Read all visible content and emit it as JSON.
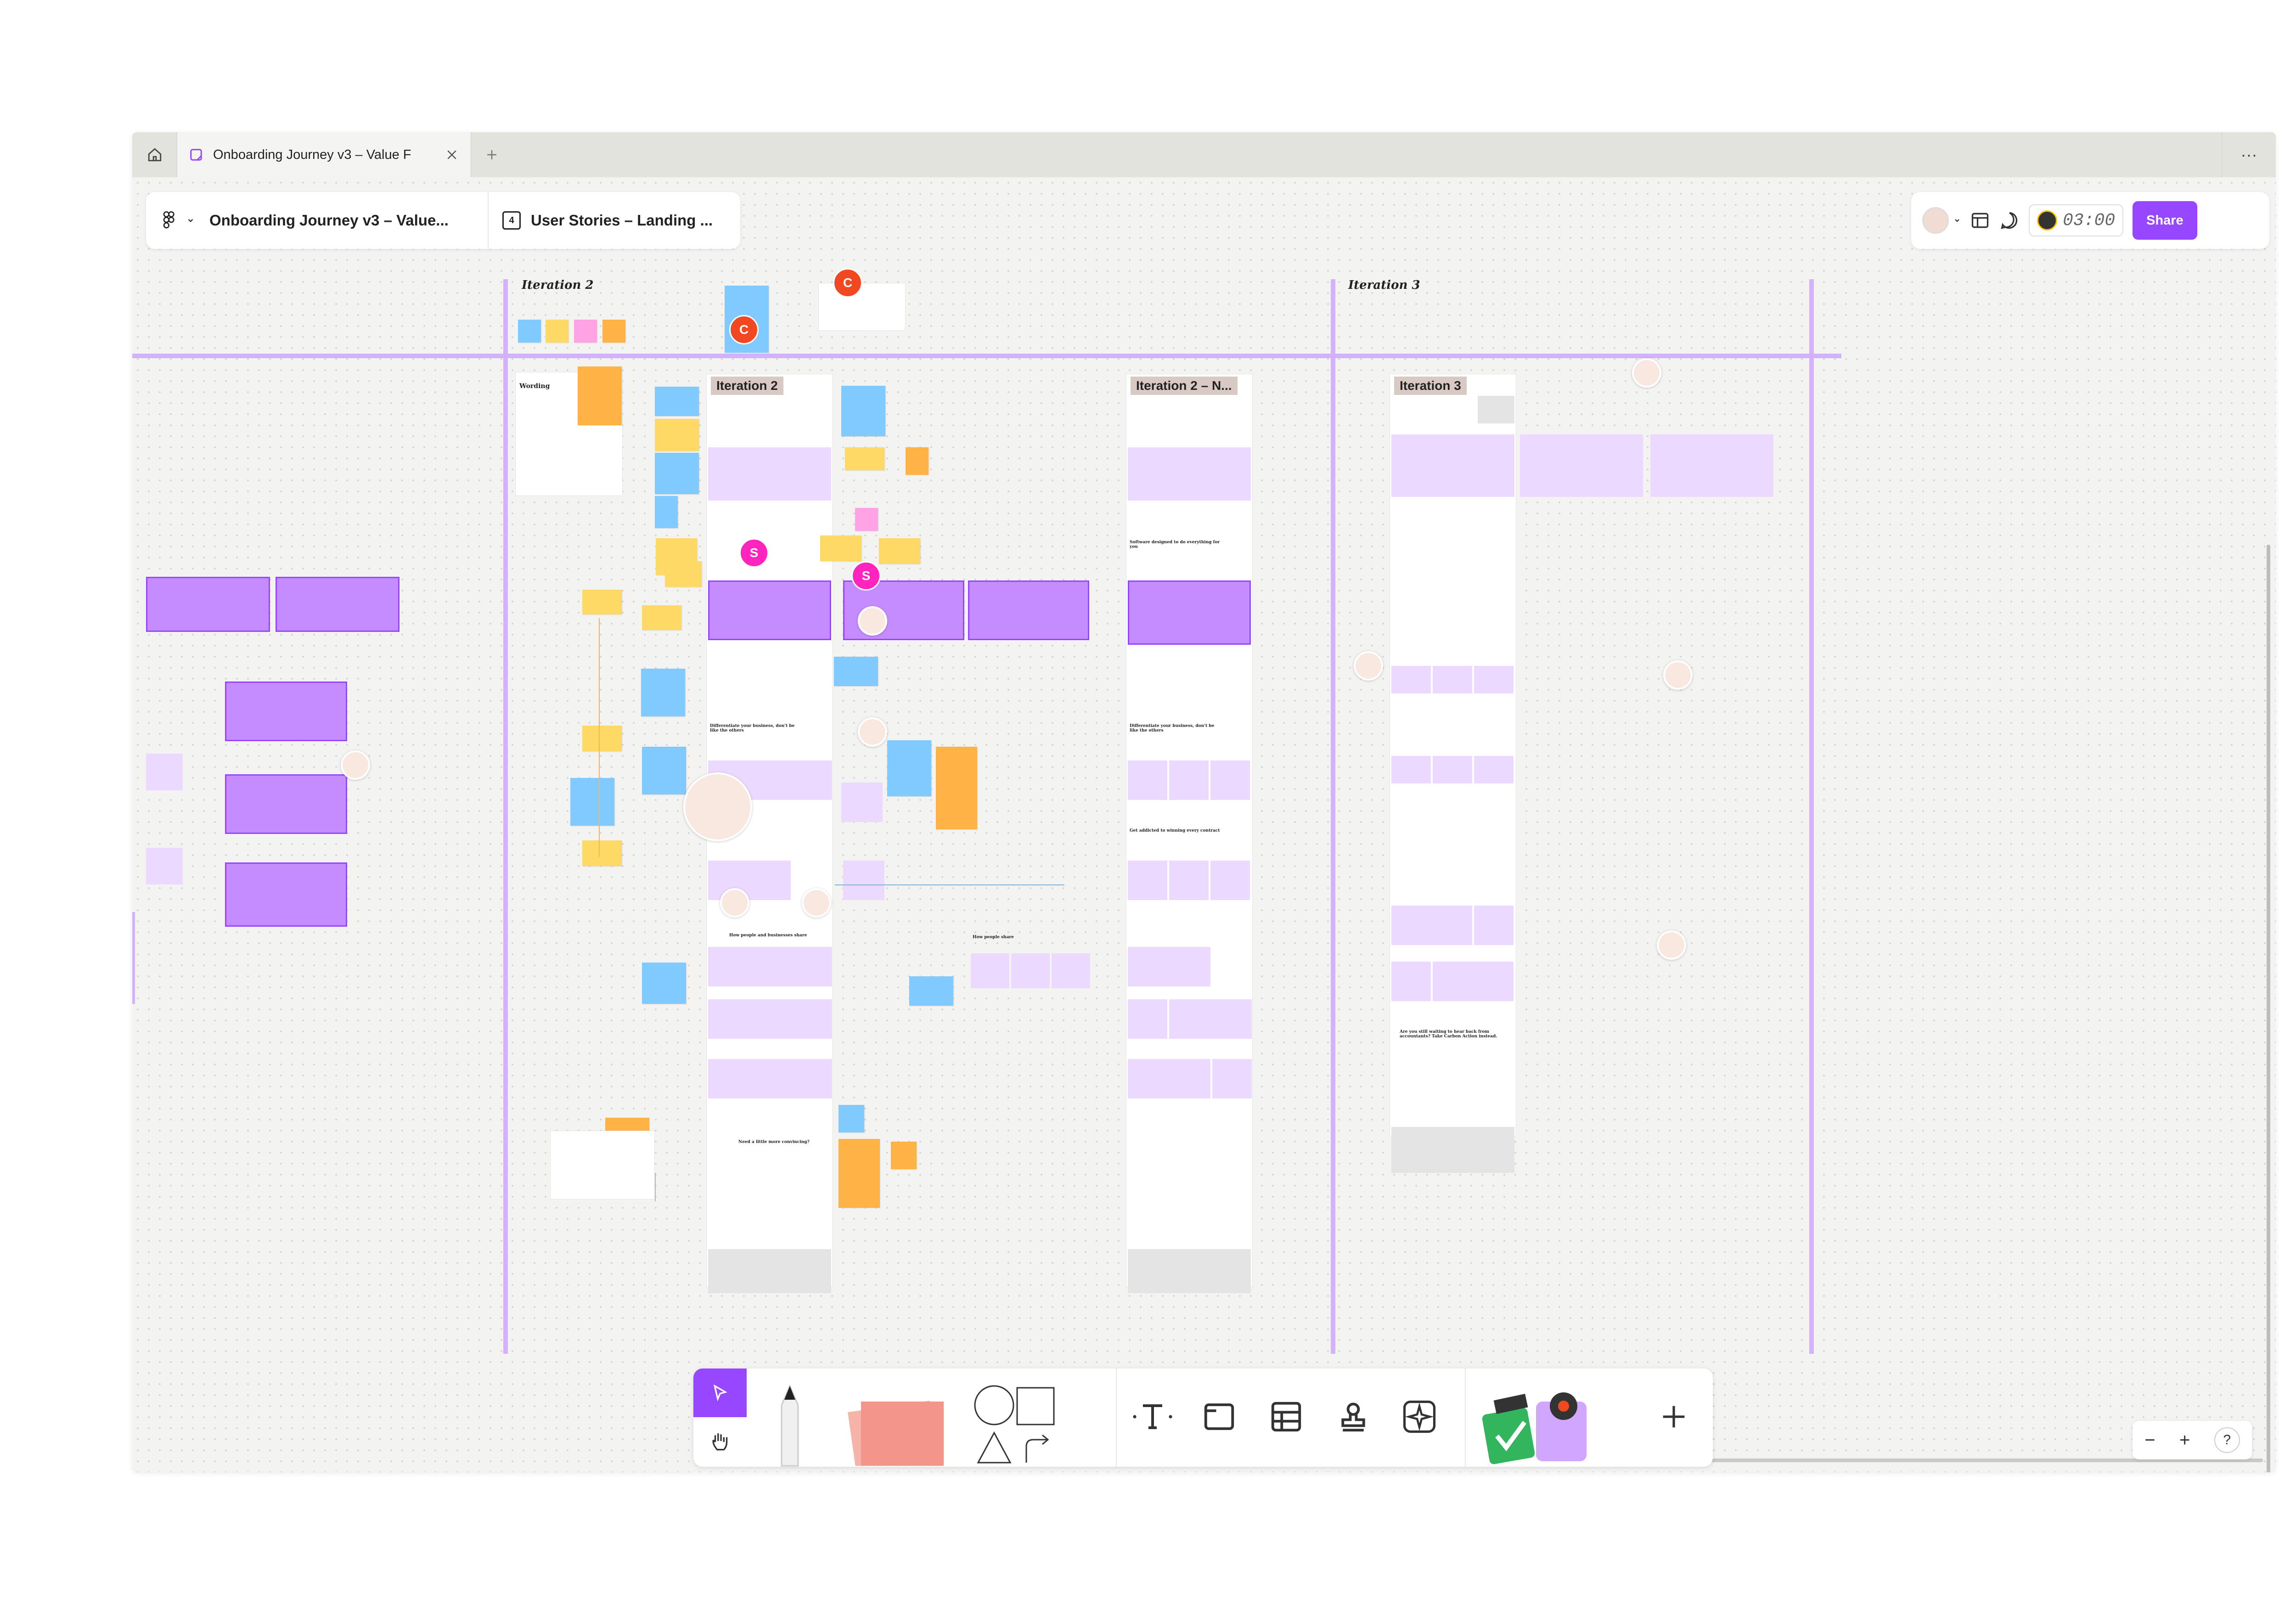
{
  "tabbar": {
    "tab_title": "Onboarding Journey v3 – Value F",
    "more_label": "···"
  },
  "breadcrumb": {
    "file_name": "Onboarding Journey v3 – Value...",
    "page_number": "4",
    "page_name": "User Stories – Landing ..."
  },
  "header_right": {
    "timer": "03:00",
    "share_label": "Share"
  },
  "sections": {
    "iteration2_heading": "Iteration 2",
    "iteration3_heading": "Iteration 3"
  },
  "frames": {
    "iter2_label": "Iteration 2",
    "iter2n_label": "Iteration 2 – N...",
    "iter3_label": "Iteration 3"
  },
  "cursors": {
    "c_badge": "C",
    "s_badge": "S"
  },
  "canvas_text": {
    "wording_title": "Wording",
    "software_heading": "Software designed to do everything for you",
    "differentiate": "Differentiate your business, don't be like the others",
    "addicted": "Get addicted to winning every contract",
    "how_people": "How people and businesses share",
    "how_people_short": "How people share",
    "more_convincing": "Need a little more convincing?",
    "cta": "Are you still waiting to hear back from accountants? Take Carbon Action instead."
  },
  "zoom_controls": {
    "minus": "−",
    "plus": "+",
    "help": "?"
  },
  "colors": {
    "accent": "#9747ff",
    "section_line": "#d4b1ff",
    "frame_purple": "#c58cff",
    "light_purple": "#ecd9ff",
    "sticky_yellow": "#ffd966",
    "sticky_blue": "#80caff",
    "sticky_orange": "#ffb347",
    "sticky_pink": "#ffa3e4",
    "cursor_c": "#f24822",
    "cursor_s": "#ff24bd"
  }
}
